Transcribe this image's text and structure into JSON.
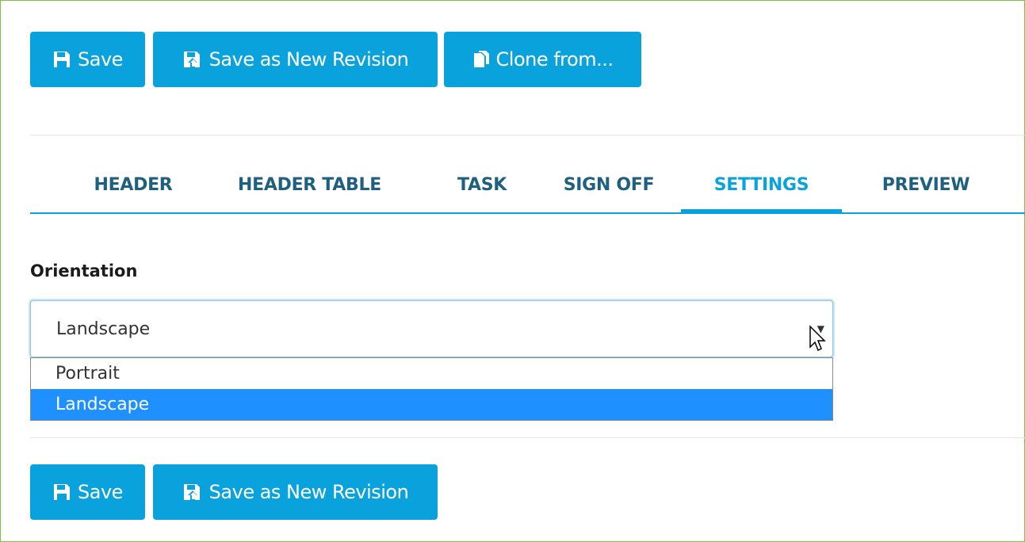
{
  "toolbar_top": {
    "save_label": "Save",
    "save_revision_label": "Save as New Revision",
    "clone_label": "Clone from..."
  },
  "tabs": [
    {
      "label": "HEADER"
    },
    {
      "label": "HEADER TABLE"
    },
    {
      "label": "TASK"
    },
    {
      "label": "SIGN OFF"
    },
    {
      "label": "SETTINGS",
      "active": true
    },
    {
      "label": "PREVIEW"
    }
  ],
  "settings": {
    "orientation_label": "Orientation",
    "orientation_value": "Landscape",
    "orientation_options": [
      "Portrait",
      "Landscape"
    ],
    "selected_option": "Landscape"
  },
  "toolbar_bottom": {
    "save_label": "Save",
    "save_revision_label": "Save as New Revision"
  },
  "colors": {
    "accent": "#0aa2dc",
    "tab_text": "#1f5f7f",
    "selected_option_bg": "#1e90ff",
    "frame_border": "#7dc242"
  }
}
